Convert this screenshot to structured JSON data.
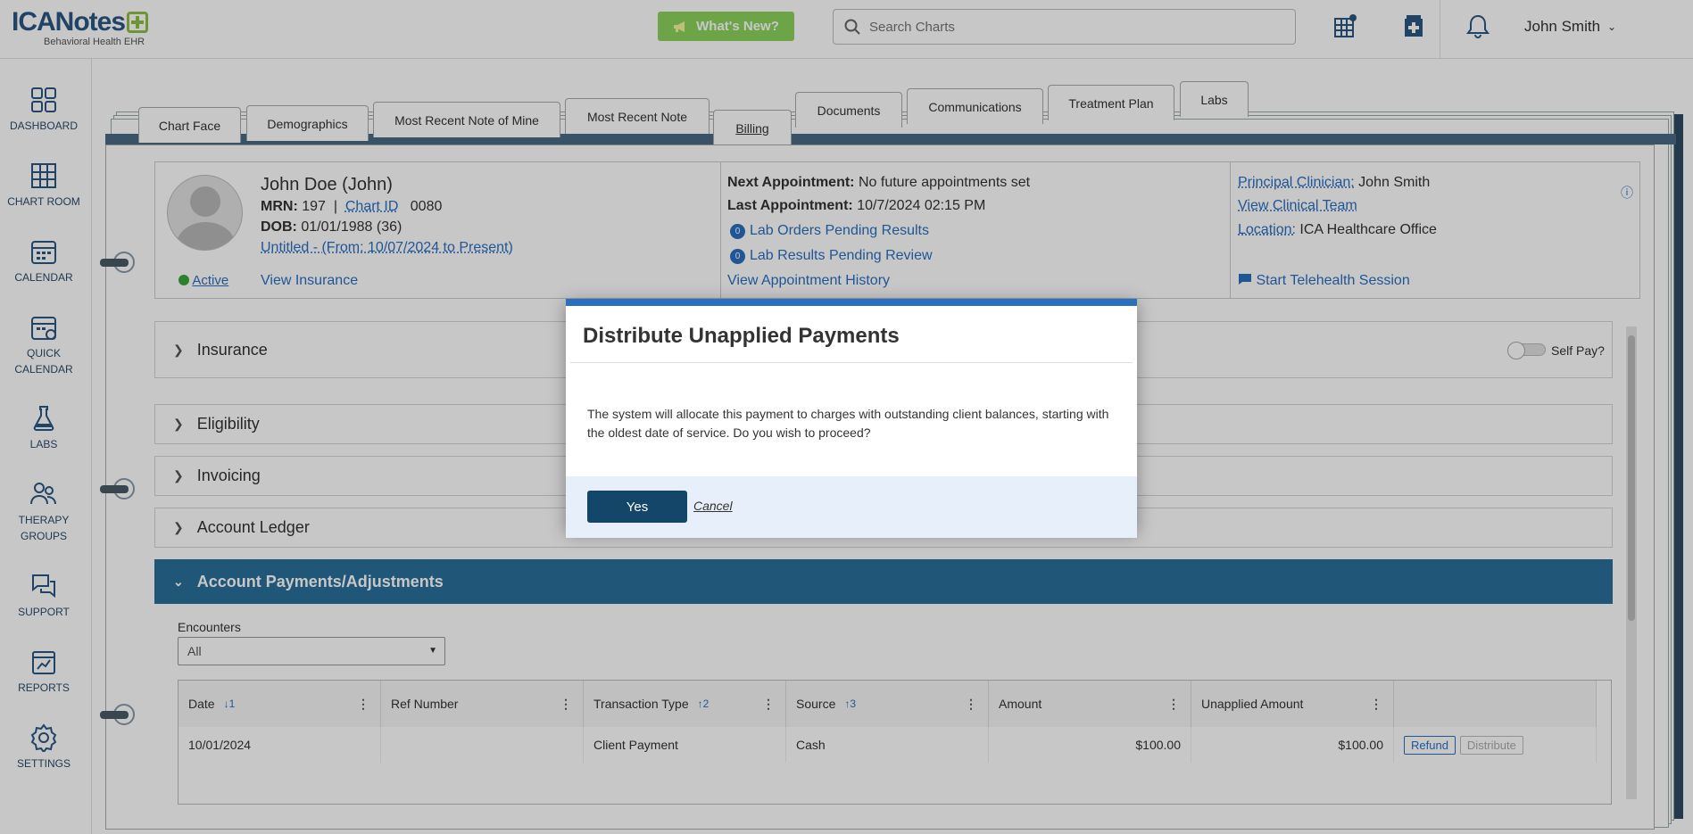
{
  "brand": {
    "name": "ICANotes",
    "tagline": "Behavioral Health EHR",
    "accent": "#2a6fc0"
  },
  "header": {
    "whats_new": "What's New?",
    "search_placeholder": "Search Charts",
    "user_name": "John Smith"
  },
  "sidenav": {
    "items": [
      {
        "label": "DASHBOARD",
        "icon": "dashboard-icon"
      },
      {
        "label": "CHART ROOM",
        "icon": "chart-room-icon"
      },
      {
        "label": "CALENDAR",
        "icon": "calendar-icon"
      },
      {
        "label": "QUICK CALENDAR",
        "icon": "quick-calendar-icon"
      },
      {
        "label": "LABS",
        "icon": "flask-icon"
      },
      {
        "label": "THERAPY GROUPS",
        "icon": "people-icon"
      },
      {
        "label": "SUPPORT",
        "icon": "chat-icon"
      },
      {
        "label": "REPORTS",
        "icon": "report-icon"
      },
      {
        "label": "SETTINGS",
        "icon": "gear-icon"
      }
    ]
  },
  "tabs": [
    "Chart Face",
    "Demographics",
    "Most Recent Note of Mine",
    "Most Recent Note",
    "Billing",
    "Documents",
    "Communications",
    "Treatment Plan",
    "Labs"
  ],
  "active_tab": "Billing",
  "patient": {
    "name": "John Doe (John)",
    "mrn_label": "MRN:",
    "mrn": "197",
    "chart_id_label": "Chart ID",
    "chart_id": "0080",
    "dob_label": "DOB:",
    "dob": "01/01/1988 (36)",
    "episode": "Untitled - (From: 10/07/2024 to Present)",
    "status": "Active",
    "view_insurance": "View Insurance"
  },
  "appointments": {
    "next_label": "Next Appointment:",
    "next_value": "No future appointments set",
    "last_label": "Last Appointment:",
    "last_value": "10/7/2024 02:15 PM",
    "lab_orders_count": "0",
    "lab_orders": "Lab Orders Pending Results",
    "lab_results_count": "0",
    "lab_results": "Lab Results Pending Review",
    "history": "View Appointment History"
  },
  "clinician": {
    "principal_label": "Principal Clinician:",
    "principal_value": "John Smith",
    "team": "View Clinical Team",
    "location_label": "Location:",
    "location_value": "ICA Healthcare Office",
    "telehealth": "Start Telehealth Session"
  },
  "sections": {
    "insurance": "Insurance",
    "self_pay": "Self Pay?",
    "eligibility": "Eligibility",
    "invoicing": "Invoicing",
    "ledger": "Account Ledger",
    "payments": "Account Payments/Adjustments"
  },
  "encounters": {
    "label": "Encounters",
    "value": "All"
  },
  "grid": {
    "columns": [
      {
        "label": "Date",
        "sort": "↓1"
      },
      {
        "label": "Ref Number",
        "sort": ""
      },
      {
        "label": "Transaction Type",
        "sort": "↑2"
      },
      {
        "label": "Source",
        "sort": "↑3"
      },
      {
        "label": "Amount",
        "sort": ""
      },
      {
        "label": "Unapplied Amount",
        "sort": ""
      }
    ],
    "rows": [
      {
        "date": "10/01/2024",
        "ref": "",
        "type": "Client Payment",
        "source": "Cash",
        "amount": "$100.00",
        "unapplied": "$100.00"
      }
    ],
    "refund": "Refund",
    "distribute": "Distribute"
  },
  "modal": {
    "title": "Distribute Unapplied Payments",
    "body": "The system will allocate this payment to charges with outstanding client balances, starting with the oldest date of service. Do you wish to proceed?",
    "yes": "Yes",
    "cancel": "Cancel"
  }
}
